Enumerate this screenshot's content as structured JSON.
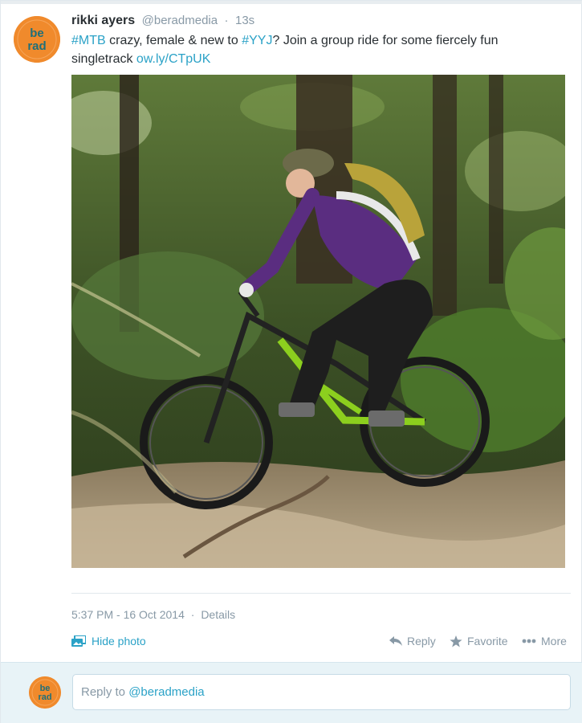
{
  "tweet": {
    "author_name": "rikki ayers",
    "author_handle": "@beradmedia",
    "separator": "·",
    "time_ago": "13s",
    "text_parts": {
      "hashtag_1": "#MTB",
      "text_1": " crazy, female & new to ",
      "hashtag_2": "#YYJ",
      "text_2": "? Join a group ride for some fiercely fun singletrack ",
      "link": "ow.ly/CTpUK"
    },
    "avatar": {
      "top_text": "be",
      "bottom_text": "rad",
      "bg_color": "#f08a2c",
      "text_color": "#1f6f7a"
    },
    "photo_alt_icon": "mountain-biker-photo",
    "timestamp_full": "5:37 PM - 16 Oct 2014",
    "details_label": "Details"
  },
  "actions": {
    "hide_photo": "Hide photo",
    "reply": "Reply",
    "favorite": "Favorite",
    "more": "More"
  },
  "reply_box": {
    "prefix": "Reply to ",
    "handle": "@beradmedia"
  },
  "colors": {
    "link": "#2ba2c7",
    "muted": "#8899a6",
    "reply_bar_bg": "#e8f3f7"
  }
}
